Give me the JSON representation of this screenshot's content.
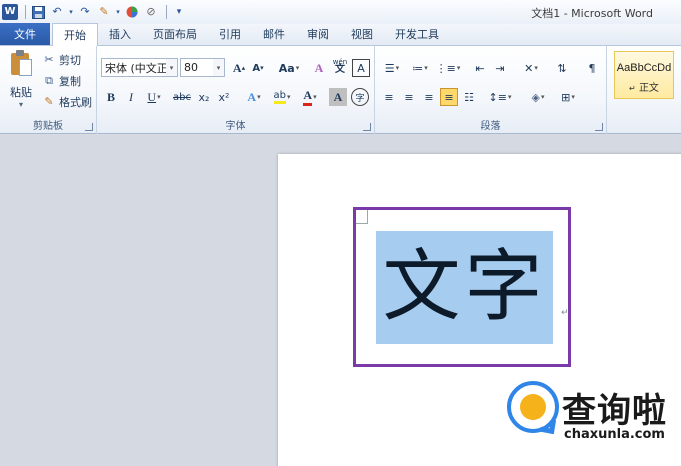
{
  "window": {
    "title": "文档1 - Microsoft Word"
  },
  "qat": {
    "app_icon": "word-logo-icon",
    "app_letter": "W",
    "save": "save-icon",
    "undo": "undo-icon",
    "redo": "redo-icon",
    "format_painter": "brush-icon",
    "color": "color-wheel-icon",
    "clear": "clear-format-icon",
    "customize": "customize-qat-icon"
  },
  "tabs": [
    {
      "label": "文件"
    },
    {
      "label": "开始"
    },
    {
      "label": "插入"
    },
    {
      "label": "页面布局"
    },
    {
      "label": "引用"
    },
    {
      "label": "邮件"
    },
    {
      "label": "审阅"
    },
    {
      "label": "视图"
    },
    {
      "label": "开发工具"
    }
  ],
  "ribbon": {
    "clipboard": {
      "label": "剪贴板",
      "paste": "粘贴",
      "cut": "剪切",
      "copy": "复制",
      "format_painter": "格式刷"
    },
    "font": {
      "label": "字体",
      "font_name": "宋体 (中文正",
      "font_size": "80",
      "grow": "A",
      "shrink": "A",
      "change_case": "Aa",
      "clear_formatting": "A",
      "phonetic": "wén",
      "char_border": "A",
      "bold": "B",
      "italic": "I",
      "underline": "U",
      "strikethrough": "abc",
      "subscript": "x₂",
      "superscript": "x²",
      "text_effects": "A",
      "highlight": "ab",
      "font_color": "A",
      "char_shading": "A",
      "enclose_char": "字",
      "highlight_color": "#f5e81b",
      "font_color_value": "#d9261c"
    },
    "paragraph": {
      "label": "段落"
    },
    "styles": {
      "sample": "AaBbCcDd",
      "name": "正文"
    }
  },
  "document": {
    "text": "文字",
    "para_mark": "↵"
  },
  "watermark": {
    "title": "查询啦",
    "url": "chaxunla.com"
  }
}
